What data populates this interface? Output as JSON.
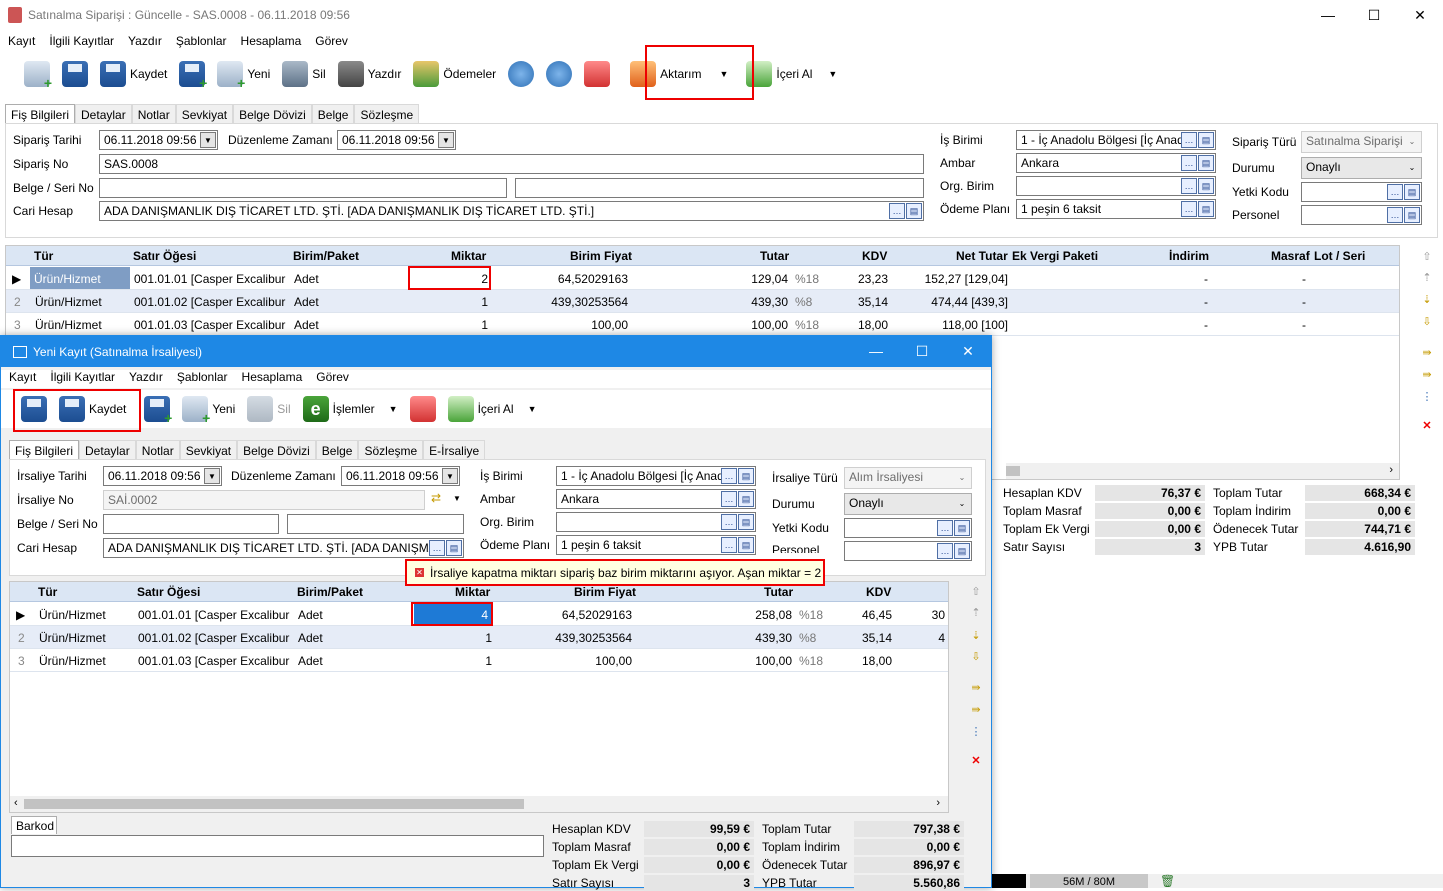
{
  "main": {
    "title": "Satınalma Siparişi : Güncelle - SAS.0008 - 06.11.2018 09:56",
    "menu": [
      "Kayıt",
      "İlgili Kayıtlar",
      "Yazdır",
      "Şablonlar",
      "Hesaplama",
      "Görev"
    ],
    "toolbar": {
      "kaydet": "Kaydet",
      "yeni": "Yeni",
      "sil": "Sil",
      "yazdir": "Yazdır",
      "odemeler": "Ödemeler",
      "aktarim": "Aktarım",
      "iceri_al": "İçeri Al"
    },
    "tabs": [
      "Fiş Bilgileri",
      "Detaylar",
      "Notlar",
      "Sevkiyat",
      "Belge Dövizi",
      "Belge",
      "Sözleşme"
    ],
    "form": {
      "siparis_tarihi_label": "Sipariş Tarihi",
      "siparis_tarihi": "06.11.2018 09:56",
      "duzenleme_label": "Düzenleme Zamanı",
      "duzenleme": "06.11.2018 09:56",
      "siparis_no_label": "Sipariş No",
      "siparis_no": "SAS.0008",
      "belge_label": "Belge / Seri No",
      "cari_label": "Cari Hesap",
      "cari": "ADA DANIŞMANLIK DIŞ TİCARET LTD. ŞTİ. [ADA DANIŞMANLIK DIŞ TİCARET LTD. ŞTİ.]",
      "is_birimi_label": "İş Birimi",
      "is_birimi": "1 - İç Anadolu Bölgesi [İç Anad",
      "ambar_label": "Ambar",
      "ambar": "Ankara",
      "org_label": "Org. Birim",
      "odeme_label": "Ödeme Planı",
      "odeme": "1 peşin 6 taksit",
      "siparis_turu_label": "Sipariş Türü",
      "siparis_turu": "Satınalma Siparişi",
      "durumu_label": "Durumu",
      "durumu": "Onaylı",
      "yetki_label": "Yetki Kodu",
      "personel_label": "Personel"
    },
    "grid": {
      "headers": [
        "Tür",
        "Satır Öğesi",
        "Birim/Paket",
        "Miktar",
        "Birim Fiyat",
        "Tutar",
        "KDV",
        "Net Tutar",
        "Ek Vergi Paketi",
        "İndirim",
        "Masraf",
        "Lot / Seri"
      ],
      "rows": [
        {
          "num": "",
          "tur": "Ürün/Hizmet",
          "oge": "001.01.01 [Casper Excalibur ...",
          "birim": "Adet",
          "miktar": "2",
          "fiyat": "64,52029163",
          "tutar": "129,04",
          "kdv_oran": "%18",
          "kdv": "23,23",
          "net": "152,27 [129,04]",
          "indirim": "-",
          "masraf": "-"
        },
        {
          "num": "2",
          "tur": "Ürün/Hizmet",
          "oge": "001.01.02 [Casper Excalibur ...",
          "birim": "Adet",
          "miktar": "1",
          "fiyat": "439,30253564",
          "tutar": "439,30",
          "kdv_oran": "%8",
          "kdv": "35,14",
          "net": "474,44 [439,3]",
          "indirim": "-",
          "masraf": "-"
        },
        {
          "num": "3",
          "tur": "Ürün/Hizmet",
          "oge": "001.01.03 [Casper Excalibur ...",
          "birim": "Adet",
          "miktar": "1",
          "fiyat": "100,00",
          "tutar": "100,00",
          "kdv_oran": "%18",
          "kdv": "18,00",
          "net": "118,00 [100]",
          "indirim": "-",
          "masraf": "-"
        }
      ]
    },
    "summary": {
      "hes_kdv_label": "Hesaplan KDV",
      "hes_kdv": "76,37 €",
      "top_tutar_label": "Toplam Tutar",
      "top_tutar": "668,34 €",
      "top_masraf_label": "Toplam Masraf",
      "top_masraf": "0,00 €",
      "top_indirim_label": "Toplam İndirim",
      "top_indirim": "0,00 €",
      "top_ek_label": "Toplam Ek Vergi",
      "top_ek": "0,00 €",
      "odenecek_label": "Ödenecek Tutar",
      "odenecek": "744,71 €",
      "satir_label": "Satır Sayısı",
      "satir": "3",
      "ypb_label": "YPB Tutar",
      "ypb": "4.616,90"
    },
    "status_memory": "56M / 80M"
  },
  "dialog": {
    "title": "Yeni Kayıt (Satınalma İrsaliyesi)",
    "menu": [
      "Kayıt",
      "İlgili Kayıtlar",
      "Yazdır",
      "Şablonlar",
      "Hesaplama",
      "Görev"
    ],
    "toolbar": {
      "kaydet": "Kaydet",
      "yeni": "Yeni",
      "sil": "Sil",
      "islemler": "İşlemler",
      "iceri_al": "İçeri Al"
    },
    "tabs": [
      "Fiş Bilgileri",
      "Detaylar",
      "Notlar",
      "Sevkiyat",
      "Belge Dövizi",
      "Belge",
      "Sözleşme",
      "E-İrsaliye"
    ],
    "form": {
      "irs_tarihi_label": "İrsaliye Tarihi",
      "irs_tarihi": "06.11.2018 09:56",
      "duzenleme_label": "Düzenleme Zamanı",
      "duzenleme": "06.11.2018 09:56",
      "irs_no_label": "İrsaliye No",
      "irs_no": "SAİ.0002",
      "belge_label": "Belge / Seri No",
      "cari_label": "Cari Hesap",
      "cari": "ADA DANIŞMANLIK DIŞ TİCARET LTD. ŞTİ. [ADA DANIŞMANLI",
      "is_birimi_label": "İş Birimi",
      "is_birimi": "1 - İç Anadolu Bölgesi [İç Anad",
      "ambar_label": "Ambar",
      "ambar": "Ankara",
      "org_label": "Org. Birim",
      "odeme_label": "Ödeme Planı",
      "odeme": "1 peşin 6 taksit",
      "irs_turu_label": "İrsaliye Türü",
      "irs_turu": "Alım İrsaliyesi",
      "durumu_label": "Durumu",
      "durumu": "Onaylı",
      "yetki_label": "Yetki Kodu",
      "personel_label": "Personel"
    },
    "error": "İrsaliye kapatma miktarı sipariş baz birim miktarını aşıyor. Aşan miktar = 2",
    "grid": {
      "headers": [
        "Tür",
        "Satır Öğesi",
        "Birim/Paket",
        "Miktar",
        "Birim Fiyat",
        "Tutar",
        "KDV"
      ],
      "rows": [
        {
          "num": "",
          "tur": "Ürün/Hizmet",
          "oge": "001.01.01 [Casper Excalibur ...",
          "birim": "Adet",
          "miktar": "4",
          "fiyat": "64,52029163",
          "tutar": "258,08",
          "kdv_oran": "%18",
          "kdv": "46,45",
          "extra": "30"
        },
        {
          "num": "2",
          "tur": "Ürün/Hizmet",
          "oge": "001.01.02 [Casper Excalibur ...",
          "birim": "Adet",
          "miktar": "1",
          "fiyat": "439,30253564",
          "tutar": "439,30",
          "kdv_oran": "%8",
          "kdv": "35,14",
          "extra": "4"
        },
        {
          "num": "3",
          "tur": "Ürün/Hizmet",
          "oge": "001.01.03 [Casper Excalibur ...",
          "birim": "Adet",
          "miktar": "1",
          "fiyat": "100,00",
          "tutar": "100,00",
          "kdv_oran": "%18",
          "kdv": "18,00",
          "extra": ""
        }
      ]
    },
    "barkod_label": "Barkod",
    "summary": {
      "hes_kdv_label": "Hesaplan KDV",
      "hes_kdv": "99,59 €",
      "top_tutar_label": "Toplam Tutar",
      "top_tutar": "797,38 €",
      "top_masraf_label": "Toplam Masraf",
      "top_masraf": "0,00 €",
      "top_indirim_label": "Toplam İndirim",
      "top_indirim": "0,00 €",
      "top_ek_label": "Toplam Ek Vergi",
      "top_ek": "0,00 €",
      "odenecek_label": "Ödenecek Tutar",
      "odenecek": "896,97 €",
      "satir_label": "Satır Sayısı",
      "satir": "3",
      "ypb_label": "YPB Tutar",
      "ypb": "5.560,86"
    }
  }
}
